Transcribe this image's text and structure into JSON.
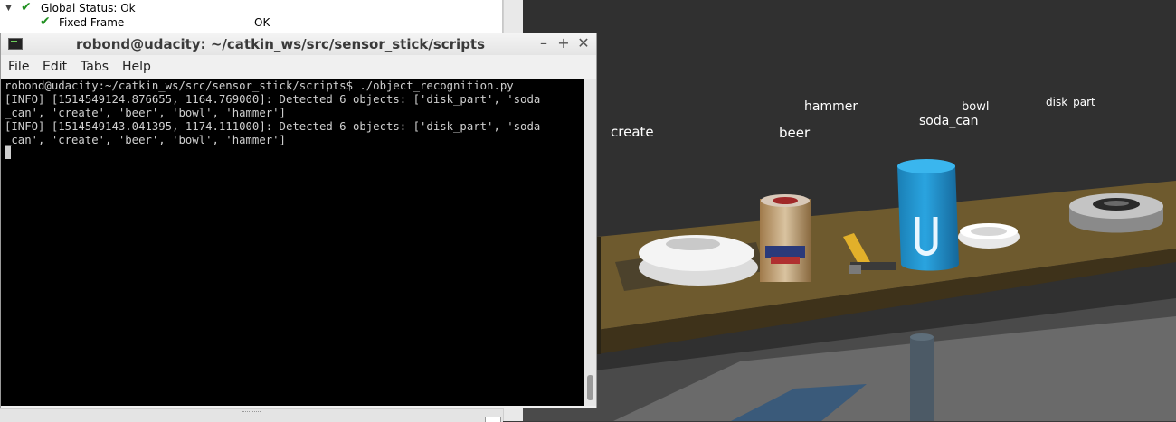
{
  "rviz": {
    "displays": [
      {
        "label": "Global Status: Ok",
        "value": ""
      },
      {
        "label": "Fixed Frame",
        "value": "OK"
      }
    ]
  },
  "terminal": {
    "title": "robond@udacity: ~/catkin_ws/src/sensor_stick/scripts",
    "menu": [
      "File",
      "Edit",
      "Tabs",
      "Help"
    ],
    "lines": [
      "robond@udacity:~/catkin_ws/src/sensor_stick/scripts$ ./object_recognition.py",
      "[INFO] [1514549124.876655, 1164.769000]: Detected 6 objects: ['disk_part', 'soda",
      "_can', 'create', 'beer', 'bowl', 'hammer']",
      "[INFO] [1514549143.041395, 1174.111000]: Detected 6 objects: ['disk_part', 'soda",
      "_can', 'create', 'beer', 'bowl', 'hammer']"
    ]
  },
  "scene": {
    "labels": {
      "create": "create",
      "beer": "beer",
      "hammer": "hammer",
      "soda_can": "soda_can",
      "bowl": "bowl",
      "disk_part": "disk_part"
    }
  },
  "colors": {
    "table": "#6e5a2e",
    "soda_can": "#1e8fc9",
    "background": "#303030"
  }
}
